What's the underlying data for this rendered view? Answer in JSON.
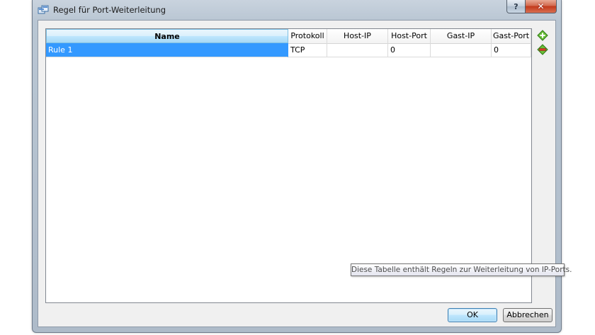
{
  "window": {
    "title": "Regel für Port-Weiterleitung",
    "help_label": "?",
    "close_label": "✕",
    "icon": "port-forwarding-icon"
  },
  "table": {
    "columns": [
      "Name",
      "Protokoll",
      "Host-IP",
      "Host-Port",
      "Gast-IP",
      "Gast-Port"
    ],
    "rows": [
      {
        "name": "Rule 1",
        "protocol": "TCP",
        "host_ip": "",
        "host_port": "0",
        "guest_ip": "",
        "guest_port": "0"
      }
    ],
    "selected_row": 0
  },
  "side_buttons": {
    "add_icon": "add-rule-icon",
    "remove_icon": "remove-rule-icon"
  },
  "tooltip": {
    "text": "Diese Tabelle enthält Regeln zur Weiterleitung von IP-Ports."
  },
  "buttons": {
    "ok_label": "OK",
    "cancel_label": "Abbrechen"
  },
  "colors": {
    "selection": "#3399ff",
    "header_selected": "#bee6fd",
    "close_button": "#c2391b"
  }
}
